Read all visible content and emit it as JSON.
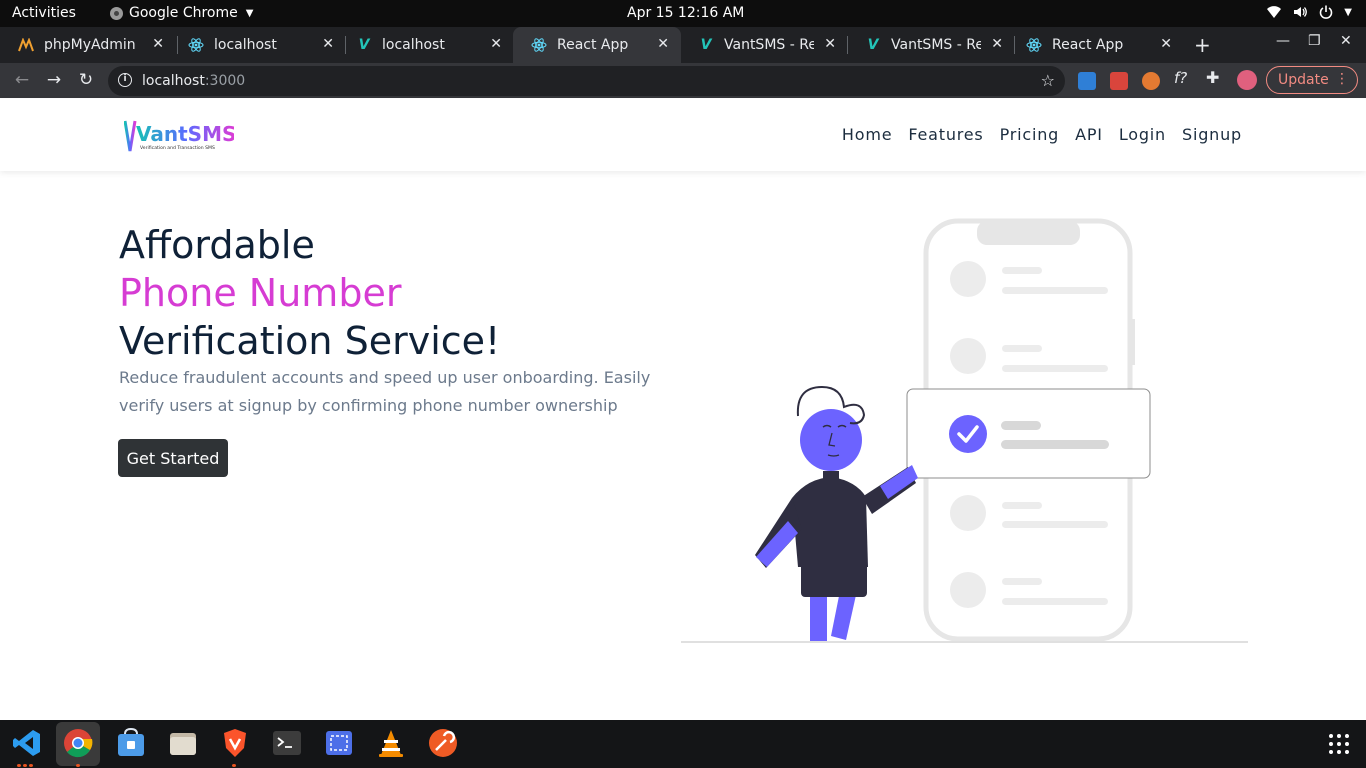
{
  "system_bar": {
    "activities": "Activities",
    "app_name": "Google Chrome",
    "clock": "Apr 15  12:16 AM"
  },
  "tabs": [
    {
      "title": "phpMyAdmin",
      "icon": "phpmyadmin-icon"
    },
    {
      "title": "localhost",
      "icon": "react-icon"
    },
    {
      "title": "localhost",
      "icon": "vant-icon"
    },
    {
      "title": "React App",
      "icon": "react-icon",
      "active": true
    },
    {
      "title": "VantSMS - Relia",
      "icon": "vant-icon"
    },
    {
      "title": "VantSMS - Relia",
      "icon": "vant-icon"
    },
    {
      "title": "React App",
      "icon": "react-icon"
    }
  ],
  "address_bar": {
    "host": "localhost",
    "port": ":3000"
  },
  "browser": {
    "update_label": "Update"
  },
  "site": {
    "brand": "VantSMS",
    "tagline": "Verification and Transaction SMS",
    "nav": [
      "Home",
      "Features",
      "Pricing",
      "API",
      "Login",
      "Signup"
    ],
    "hero": {
      "line1": "Affordable",
      "line2": "Phone Number",
      "line3": "Verification Service!",
      "description": "Reduce fraudulent accounts and speed up user onboarding. Easily verify users at signup by confirming phone number ownership",
      "cta": "Get Started"
    }
  },
  "colors": {
    "accent": "#d63cd3",
    "illustration_purple": "#6c63ff",
    "heading": "#0f2137",
    "button_bg": "#2f3336"
  },
  "dock": [
    "vscode-icon",
    "chrome-icon",
    "software-icon",
    "files-icon",
    "brave-icon",
    "terminal-icon",
    "screenshot-icon",
    "vlc-icon",
    "postman-icon",
    "app-grid-icon"
  ]
}
